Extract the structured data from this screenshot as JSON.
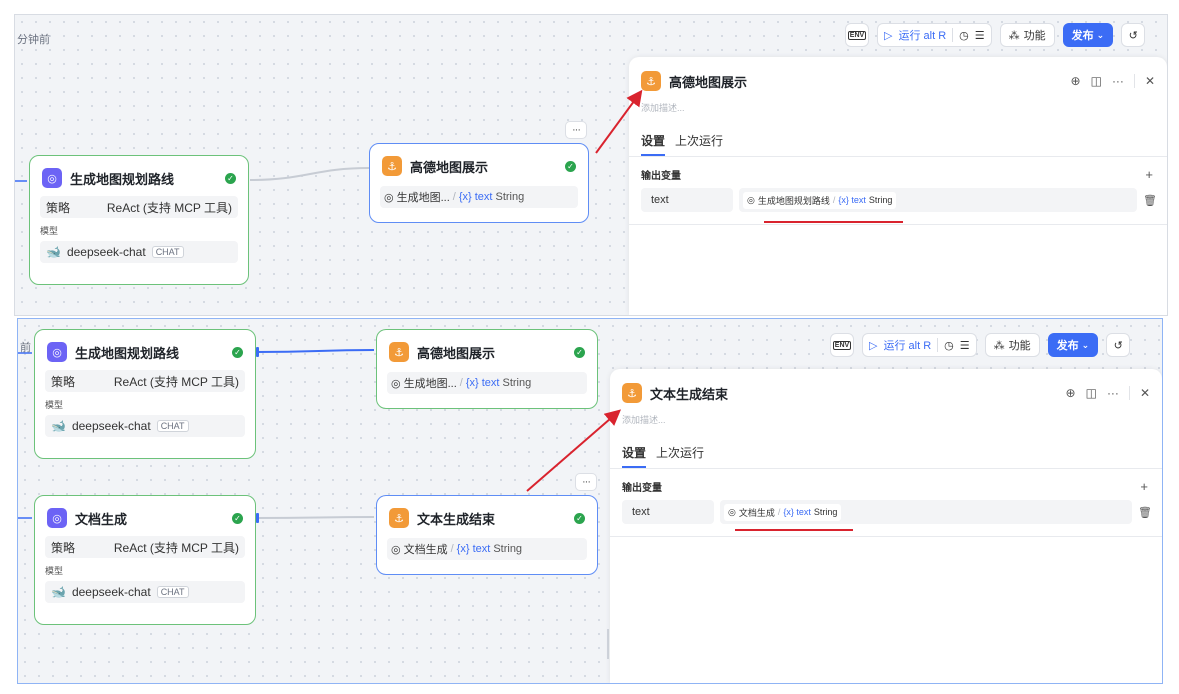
{
  "top": {
    "timestamp": "分钟前",
    "toolbar": {
      "env": "ENV",
      "run": "运行 alt R",
      "func": "功能",
      "publish": "发布"
    },
    "nodes": {
      "llm": {
        "title": "生成地图规划路线",
        "strategy_label": "策略",
        "strategy_value": "ReAct (支持 MCP 工具)",
        "model_label": "模型",
        "model_name": "deepseek-chat",
        "model_tag": "CHAT"
      },
      "end": {
        "title": "高德地图展示",
        "ref_source": "生成地图...",
        "ref_var": "{x} text",
        "ref_type": "String"
      }
    },
    "panel": {
      "title": "高德地图展示",
      "description_placeholder": "添加描述...",
      "tabs": [
        "设置",
        "上次运行"
      ],
      "section_title": "输出变量",
      "var_name": "text",
      "var_source": "生成地图规划路线",
      "var_ref": "{x} text",
      "var_type": "String"
    }
  },
  "bottom": {
    "timestamp": "前",
    "toolbar": {
      "env": "ENV",
      "run": "运行 alt R",
      "func": "功能",
      "publish": "发布"
    },
    "nodes": {
      "llm1": {
        "title": "生成地图规划路线",
        "strategy_label": "策略",
        "strategy_value": "ReAct (支持 MCP 工具)",
        "model_label": "模型",
        "model_name": "deepseek-chat",
        "model_tag": "CHAT"
      },
      "end1": {
        "title": "高德地图展示",
        "ref_source": "生成地图...",
        "ref_var": "{x} text",
        "ref_type": "String"
      },
      "llm2": {
        "title": "文档生成",
        "strategy_label": "策略",
        "strategy_value": "ReAct (支持 MCP 工具)",
        "model_label": "模型",
        "model_name": "deepseek-chat",
        "model_tag": "CHAT"
      },
      "end2": {
        "title": "文本生成结束",
        "ref_source": "文档生成",
        "ref_var": "{x} text",
        "ref_type": "String"
      }
    },
    "panel": {
      "title": "文本生成结束",
      "description_placeholder": "添加描述...",
      "tabs": [
        "设置",
        "上次运行"
      ],
      "section_title": "输出变量",
      "var_name": "text",
      "var_source": "文档生成",
      "var_ref": "{x} text",
      "var_type": "String"
    }
  },
  "icons": {
    "llm": "agent-icon",
    "end": "end-icon",
    "model": "deepseek-whale-icon",
    "check": "check-icon"
  },
  "colors": {
    "accent": "#3b6cf5",
    "success": "#2ba44e",
    "node_green_border": "#6cc27a",
    "node_blue_border": "#5f8df5",
    "annotation_red": "#d9232e",
    "llm_icon": "#6c63f5",
    "end_icon": "#f29a38"
  }
}
